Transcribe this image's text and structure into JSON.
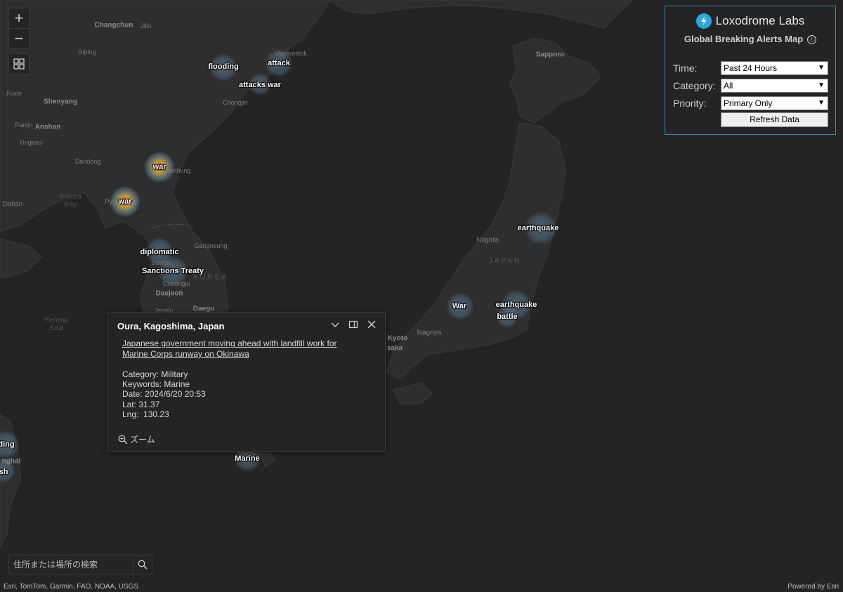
{
  "controls": {
    "zoom_in": "+",
    "zoom_out": "−"
  },
  "panel": {
    "brand": "Loxodrome Labs",
    "subtitle": "Global Breaking Alerts Map",
    "info_icon": "ⓘ",
    "time_label": "Time:",
    "time_value": "Past 24 Hours",
    "category_label": "Category:",
    "category_value": "All",
    "priority_label": "Priority:",
    "priority_value": "Primary Only",
    "refresh_label": "Refresh Data",
    "accent_color": "#2e8fb3"
  },
  "popup": {
    "title": "Oura, Kagoshima, Japan",
    "headline": "Japanese government moving ahead with landfill work for Marine Corps runway on Okinawa",
    "category": "Category: Military",
    "keywords": "Keywords: Marine",
    "date": "Date: 2024/6/20 20:53",
    "lat": "Lat: 31.37",
    "lng": "Lng:  130.23",
    "zoom_label": "ズーム"
  },
  "search": {
    "placeholder": "住所または場所の検索"
  },
  "attribution": {
    "left": "Esri, TomTom, Garmin, FAO, NOAA, USGS",
    "right": "Powered by Esri"
  },
  "alerts": [
    {
      "label": "flooding",
      "intensity": "low"
    },
    {
      "label": "attack",
      "intensity": "low"
    },
    {
      "label": "attacks war",
      "intensity": "low"
    },
    {
      "label": "war",
      "intensity": "high"
    },
    {
      "label": "war",
      "intensity": "high"
    },
    {
      "label": "diplomatic",
      "intensity": "low"
    },
    {
      "label": "Sanctions Treaty",
      "intensity": "low"
    },
    {
      "label": "earthquake",
      "intensity": "low"
    },
    {
      "label": "War",
      "intensity": "low"
    },
    {
      "label": "earthquake",
      "intensity": "low"
    },
    {
      "label": "battle",
      "intensity": "low"
    },
    {
      "label": "Marine",
      "intensity": "low"
    },
    {
      "label": "ding",
      "intensity": "low"
    },
    {
      "label": "sh",
      "intensity": "low"
    }
  ],
  "basemap_labels": {
    "changchun": "Changchun",
    "jilin": "Jilin",
    "siping": "Siping",
    "shenyang": "Shenyang",
    "fuxin": "Fuxin",
    "anshan": "Anshan",
    "panjin": "Panjin",
    "yingkou": "Yingkou",
    "dandong": "Dandong",
    "korea_bay": "Korea Bay",
    "vladivostok": "Vladivostok",
    "chongjin": "Chongjin",
    "hamhung": "Hamhung",
    "pyongyang": "Pyongyang",
    "sapporo": "Sapporo",
    "niigata": "Niigata",
    "japan": "JAPAN",
    "gangneung": "Gangneung",
    "suwon": "Suwon",
    "cheongju": "Cheongju",
    "daejeon": "Daejeon",
    "daegu": "Daegu",
    "jeonju": "Jeonju",
    "south_korea": "KOREA",
    "yellow_sea": "Yellow Sea",
    "nagoya": "Nagoya",
    "kyoto": "Kyoto",
    "osaka": "saka",
    "shanghai": "nghai",
    "dalian": "Dalian"
  }
}
